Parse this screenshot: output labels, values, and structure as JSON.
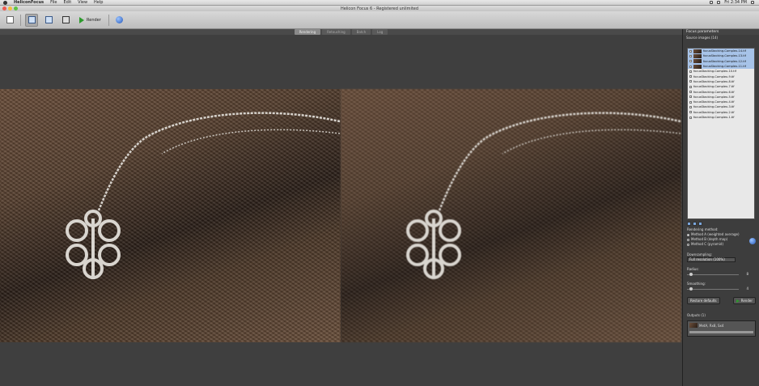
{
  "menubar": {
    "app": "HeliconFocus",
    "items": [
      "File",
      "Edit",
      "View",
      "Help"
    ],
    "clock": "Fri 2:34 PM"
  },
  "window": {
    "title": "Helicon Focus 6 - Registered unlimited"
  },
  "toolbar": {
    "render_label": "Render"
  },
  "tabs": [
    "Rendering",
    "Retouching",
    "Batch",
    "Log"
  ],
  "side": {
    "header": "Focus parameters",
    "source_label": "Source images (14)",
    "images": [
      "focusStacking-Complex-14.tif",
      "focusStacking-Complex-13.tif",
      "focusStacking-Complex-12.tif",
      "focusStacking-Complex-11.tif",
      "focusStacking-Complex-10.tif",
      "focusStacking-Complex-9.tif",
      "focusStacking-Complex-8.tif",
      "focusStacking-Complex-7.tif",
      "focusStacking-Complex-6.tif",
      "focusStacking-Complex-5.tif",
      "focusStacking-Complex-4.tif",
      "focusStacking-Complex-3.tif",
      "focusStacking-Complex-2.tif",
      "focusStacking-Complex-1.tif"
    ],
    "rendering_method_label": "Rendering method:",
    "methods": [
      "Method A (weighted average)",
      "Method B (depth map)",
      "Method C (pyramid)"
    ],
    "downsampling_label": "Downsampling:",
    "downsampling_value": "Full resolution (100%)",
    "radius_label": "Radius:",
    "radius_value": "8",
    "smoothing_label": "Smoothing:",
    "smoothing_value": "4",
    "restore_label": "Restore defaults",
    "render_label": "Render",
    "outputs_label": "Outputs (1)",
    "output_item": "MetA, Rx8, Sx4"
  },
  "colors": {
    "accent_green": "#2c9a2c",
    "selection_blue": "#a7c3e8"
  }
}
